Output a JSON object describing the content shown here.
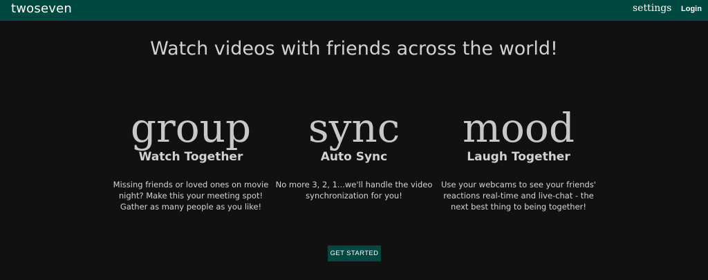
{
  "nav": {
    "brand": "twoseven",
    "settings": "settings",
    "login": "Login"
  },
  "hero": {
    "headline": "Watch videos with friends across the world!"
  },
  "features": [
    {
      "word": "group",
      "title": "Watch Together",
      "description": "Missing friends or loved ones on movie night? Make this your meeting spot! Gather as many people as you like!"
    },
    {
      "word": "sync",
      "title": "Auto Sync",
      "description": "No more 3, 2, 1...we'll handle the video synchronization for you!"
    },
    {
      "word": "mood",
      "title": "Laugh Together",
      "description": "Use your webcams to see your friends' reactions real-time and live-chat - the next best thing to being together!"
    }
  ],
  "cta": {
    "label": "GET STARTED"
  },
  "colors": {
    "navbar": "#004940",
    "background": "#111111",
    "button": "#004940"
  }
}
